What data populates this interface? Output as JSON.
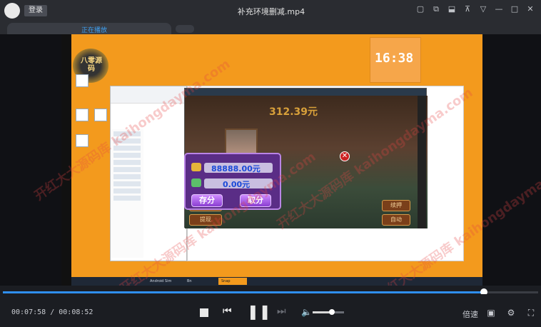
{
  "titlebar": {
    "login_label": "登录",
    "title": "补充环境删减.mp4",
    "window_icons": [
      "skin-icon",
      "mini-mode-icon",
      "pip-icon",
      "pin-icon",
      "menu-icon",
      "minimize-icon",
      "maximize-icon",
      "close-icon"
    ]
  },
  "tabs": [
    {
      "label": "正在播放"
    }
  ],
  "video": {
    "logo_text": "八零源码",
    "clock_time": "16:38",
    "game": {
      "header_value": "312.39元",
      "left_buttons": [
        "存分",
        "提现"
      ],
      "right_buttons": [
        "续押",
        "自动"
      ]
    },
    "dialog": {
      "field1_value": "88888.00元",
      "field2_value": "0.00元",
      "save_label": "存分",
      "withdraw_label": "取分"
    },
    "taskbar_items": [
      "Android Sim",
      "Bn",
      "Snap"
    ],
    "watermark": "开红大大源码库 kaihongdayma.com"
  },
  "playback": {
    "current_time": "00:07:58",
    "separator": "/",
    "total_time": "00:08:52",
    "progress": 0.898,
    "volume": 0.62,
    "speed_label": "倍速"
  },
  "colors": {
    "accent": "#2f8ff0",
    "desktop_orange": "#f39a1d",
    "dialog_purple": "#5a2d86"
  }
}
